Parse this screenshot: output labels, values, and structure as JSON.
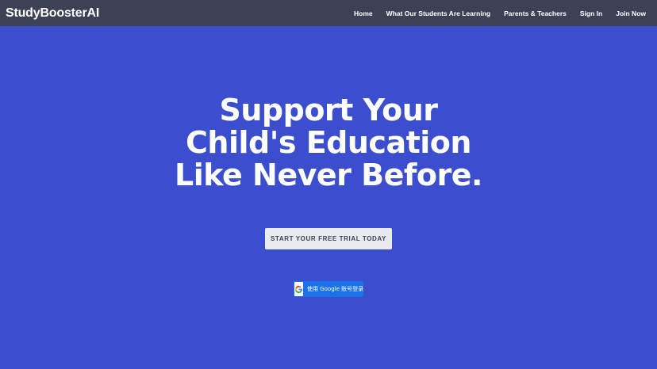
{
  "navbar": {
    "brand": "StudyBoosterAI",
    "links": [
      {
        "label": "Home"
      },
      {
        "label": "What Our Students Are Learning"
      },
      {
        "label": "Parents & Teachers"
      },
      {
        "label": "Sign In"
      },
      {
        "label": "Join Now"
      }
    ]
  },
  "hero": {
    "title_lines": [
      "Support Your",
      "Child's Education",
      "Like Never Before."
    ],
    "cta_label": "START YOUR FREE TRIAL TODAY",
    "google_signin": {
      "label": "使用 Google 账号登录",
      "icon": "google-g-icon"
    }
  },
  "colors": {
    "background": "#3b4fce",
    "navbar": "#3d4155",
    "cta_bg": "#e9eaf0",
    "google_blue": "#1a73e8"
  }
}
